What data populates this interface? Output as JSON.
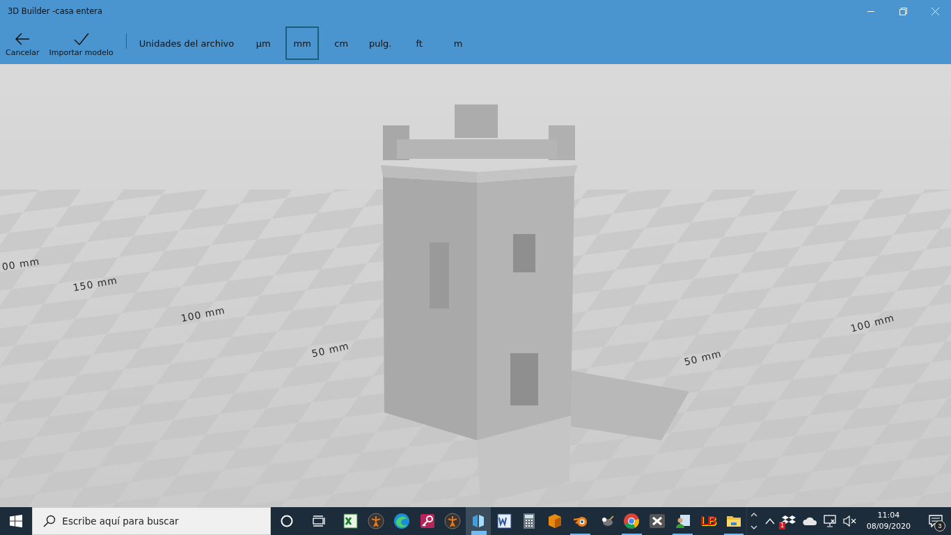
{
  "window": {
    "title": "3D Builder -casa entera"
  },
  "toolbar": {
    "actions": [
      {
        "kind": "back",
        "label": "Cancelar"
      },
      {
        "kind": "check",
        "label": "Importar modelo"
      }
    ],
    "units_label": "Unidades del archivo",
    "units": [
      {
        "label": "µm",
        "selected": false
      },
      {
        "label": "mm",
        "selected": true
      },
      {
        "label": "cm",
        "selected": false
      },
      {
        "label": "pulg.",
        "selected": false
      },
      {
        "label": "ft",
        "selected": false
      },
      {
        "label": "m",
        "selected": false
      }
    ]
  },
  "viewport": {
    "scale_labels": [
      "00 mm",
      "150 mm",
      "100 mm",
      "50 mm",
      "50 mm",
      "100 mm"
    ]
  },
  "taskbar": {
    "search": {
      "placeholder": "Escribe aquí para buscar"
    },
    "apps": [
      {
        "kind": "excel",
        "running": false,
        "active": false
      },
      {
        "kind": "figure",
        "running": false,
        "active": false
      },
      {
        "kind": "edge",
        "running": false,
        "active": false
      },
      {
        "kind": "key",
        "running": false,
        "active": false
      },
      {
        "kind": "figure",
        "running": false,
        "active": false
      },
      {
        "kind": "builder",
        "running": true,
        "active": true
      },
      {
        "kind": "word",
        "running": false,
        "active": false
      },
      {
        "kind": "calculator",
        "running": false,
        "active": false
      },
      {
        "kind": "box",
        "running": false,
        "active": false
      },
      {
        "kind": "blender",
        "running": true,
        "active": false
      },
      {
        "kind": "gimp",
        "running": false,
        "active": false
      },
      {
        "kind": "chrome",
        "running": true,
        "active": false
      },
      {
        "kind": "xapp",
        "running": false,
        "active": false
      },
      {
        "kind": "people",
        "running": true,
        "active": false
      },
      {
        "kind": "letters",
        "label": "LB",
        "running": false,
        "active": false
      },
      {
        "kind": "folder",
        "running": true,
        "active": false
      }
    ],
    "tray": {
      "dropbox_badge": "1",
      "time": "11:04",
      "date": "08/09/2020",
      "notifications": "3"
    }
  }
}
